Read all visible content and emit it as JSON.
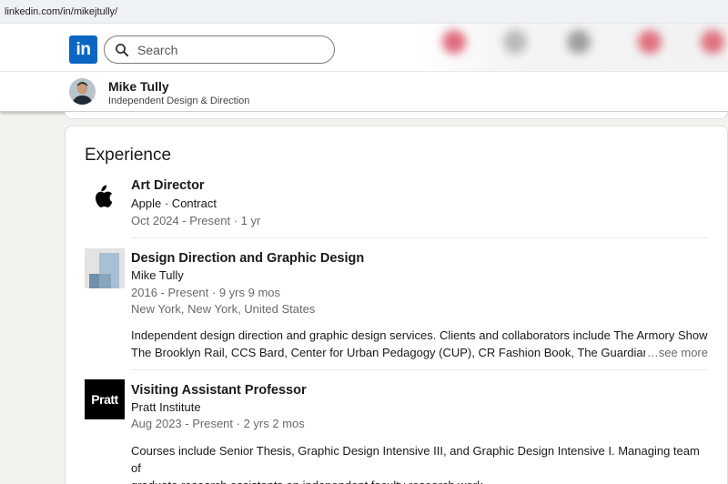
{
  "browser": {
    "url": "linkedin.com/in/mikejtully/"
  },
  "nav": {
    "logo_text": "in",
    "brand_color": "#0a66c2",
    "search_placeholder": "Search"
  },
  "profile": {
    "name": "Mike Tully",
    "headline": "Independent Design & Direction"
  },
  "experience": {
    "title": "Experience",
    "items": [
      {
        "logo": "apple-logo",
        "role": "Art Director",
        "company": "Apple · Contract",
        "dates": "Oct 2024 - Present · 1 yr"
      },
      {
        "logo": "mike-tully-studio-logo",
        "role": "Design Direction and Graphic Design",
        "company": "Mike Tully",
        "dates": "2016 - Present · 9 yrs 9 mos",
        "location": "New York, New York, United States",
        "description_line1": "Independent design direction and graphic design services. Clients and collaborators include The Armory Show,",
        "description_line2": "The Brooklyn Rail, CCS Bard, Center for Urban Pedagogy (CUP), CR Fashion Book, The Guardian, Lincol",
        "see_more": "…see more"
      },
      {
        "logo": "pratt-logo",
        "logo_text": "Pratt",
        "role": "Visiting Assistant Professor",
        "company": "Pratt Institute",
        "dates": "Aug 2023 - Present · 2 yrs 2 mos",
        "description_line1": "Courses include Senior Thesis, Graphic Design Intensive III, and Graphic Design Intensive I. Managing team of",
        "description_line2": "graduate research assistants on independent faculty research work."
      }
    ]
  }
}
